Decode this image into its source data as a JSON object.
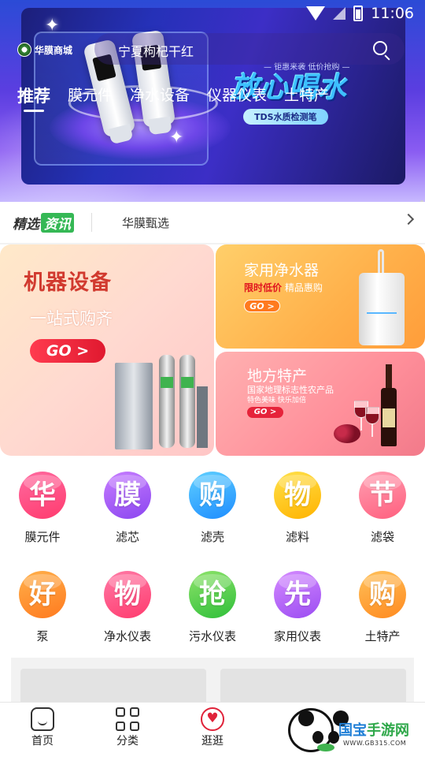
{
  "status_bar": {
    "time": "11:06"
  },
  "header": {
    "logo_text": "华膜商城",
    "search_query": "宁夏枸杞干红",
    "tabs": [
      {
        "label": "推荐",
        "active": true
      },
      {
        "label": "膜元件",
        "active": false
      },
      {
        "label": "净水设备",
        "active": false
      },
      {
        "label": "仪器仪表",
        "active": false
      },
      {
        "label": "土特产",
        "active": false
      }
    ]
  },
  "banner": {
    "subtag": "— 钜惠来袭 低价抢购 —",
    "slogan": "放心喝水",
    "pill": "TDS水质检测笔"
  },
  "news_bar": {
    "brand_prefix": "精选",
    "brand_highlight": "资讯",
    "text": "华膜甄选"
  },
  "promos": {
    "big": {
      "title": "机器设备",
      "subtitle": "一站式购齐",
      "cta": "GO >"
    },
    "right_top": {
      "title": "家用净水器",
      "tag_red": "限时低价",
      "tag_rest": "精品惠购",
      "cta": "GO >"
    },
    "right_bottom": {
      "title": "地方特产",
      "line1": "国家地理标志性农产品",
      "line2": "特色美味 快乐加倍",
      "cta": "GO >"
    }
  },
  "categories": [
    {
      "glyph": "华",
      "label": "膜元件",
      "color_from": "#ff6aa0",
      "color_to": "#ff3b6e"
    },
    {
      "glyph": "膜",
      "label": "滤芯",
      "color_from": "#c77dff",
      "color_to": "#8b46f0"
    },
    {
      "glyph": "购",
      "label": "滤壳",
      "color_from": "#5fd0ff",
      "color_to": "#1e8dff"
    },
    {
      "glyph": "物",
      "label": "滤料",
      "color_from": "#ffe14a",
      "color_to": "#ffb300"
    },
    {
      "glyph": "节",
      "label": "滤袋",
      "color_from": "#ff9fb2",
      "color_to": "#ff5f7e"
    },
    {
      "glyph": "好",
      "label": "泵",
      "color_from": "#ffb04a",
      "color_to": "#ff7a1f"
    },
    {
      "glyph": "物",
      "label": "净水仪表",
      "color_from": "#ff7aa6",
      "color_to": "#ff3b6e"
    },
    {
      "glyph": "抢",
      "label": "污水仪表",
      "color_from": "#8ee36a",
      "color_to": "#2fbf3a"
    },
    {
      "glyph": "先",
      "label": "家用仪表",
      "color_from": "#d58bff",
      "color_to": "#9b4cf2"
    },
    {
      "glyph": "购",
      "label": "土特产",
      "color_from": "#ffc15a",
      "color_to": "#ff8a1f"
    }
  ],
  "bottom_nav": [
    {
      "label": "首页",
      "icon": "home-icon"
    },
    {
      "label": "分类",
      "icon": "category-grid-icon"
    },
    {
      "label": "逛逛",
      "icon": "heart-chat-icon"
    }
  ],
  "watermark": {
    "name_a": "国宝",
    "name_b": "手游网",
    "url": "WWW.GB315.COM"
  }
}
